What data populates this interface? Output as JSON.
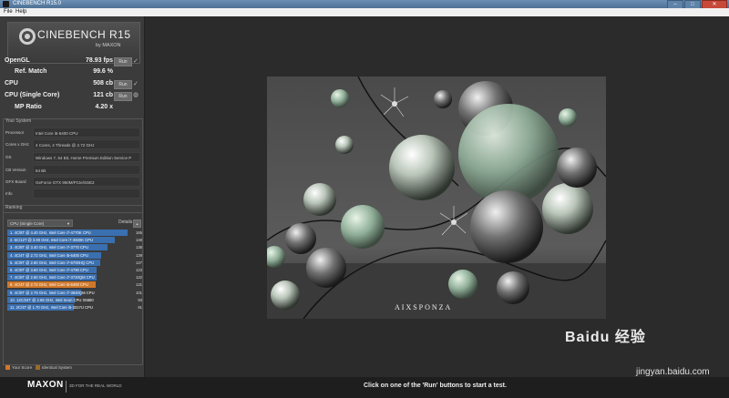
{
  "window": {
    "title": "CINEBENCH R15.0"
  },
  "menu": {
    "file": "File",
    "help": "Help"
  },
  "logo": {
    "name": "CINEBENCH R15",
    "by": "by MAXON"
  },
  "results": {
    "opengl_label": "OpenGL",
    "opengl_value": "78.93 fps",
    "refmatch_label": "Ref. Match",
    "refmatch_value": "99.6 %",
    "cpu_label": "CPU",
    "cpu_value": "508 cb",
    "cpu_single_label": "CPU (Single Core)",
    "cpu_single_value": "121 cb",
    "mp_label": "MP Ratio",
    "mp_value": "4.20 x",
    "run_label": "Run"
  },
  "system": {
    "header": "Your System",
    "rows": [
      {
        "label": "Processor",
        "value": "Intel Core i5-6400 CPU"
      },
      {
        "label": "Cores x GHz",
        "value": "4 Cores, 4 Threads @ 2.72 GHz"
      },
      {
        "label": "OS",
        "value": "Windows 7, 64 Bit, Home Premium Edition Service P"
      },
      {
        "label": "CB Version",
        "value": "64 Bit"
      },
      {
        "label": "GFX Board",
        "value": "GeForce GTX 950M/PCIe/SSE2"
      },
      {
        "label": "Info",
        "value": ""
      }
    ]
  },
  "ranking": {
    "header": "Ranking",
    "selected": "CPU (Single Core)",
    "details": "Details",
    "max_score": 165,
    "rows": [
      {
        "label": "1. 4C/8T @ 4.40 GHz, Intel Core i7-4770K CPU",
        "score": 165,
        "kind": "ref"
      },
      {
        "label": "2. 6C/12T @ 3.90 GHz, Intel Core i7-3930K CPU",
        "score": 148,
        "kind": "ref"
      },
      {
        "label": "3. 4C/8T @ 3.40 GHz, Intel Core i7-3770 CPU",
        "score": 138,
        "kind": "ref"
      },
      {
        "label": "4. 4C/4T @ 2.72 GHz, Intel Core i5-6400 CPU",
        "score": 129,
        "kind": "ref"
      },
      {
        "label": "5. 4C/8T @ 2.60 GHz, Intel Core i7-6700HQ CPU",
        "score": 127,
        "kind": "ref"
      },
      {
        "label": "6. 4C/8T @ 3.60 GHz, Intel Core i7-4790 CPU",
        "score": 123,
        "kind": "ref"
      },
      {
        "label": "7. 4C/8T @ 2.60 GHz, Intel Core i7-3720QM CPU",
        "score": 122,
        "kind": "ref"
      },
      {
        "label": "8. 4C/4T @ 2.72 GHz, Intel Core i5-6400 CPU",
        "score": 121,
        "kind": "yours"
      },
      {
        "label": "9. 4C/8T @ 2.79 GHz, Intel Core i7-3840QM CPU",
        "score": 101,
        "kind": "ref"
      },
      {
        "label": "10. 12C/24T @ 2.66 GHz, Intel Xeon CPU X5650",
        "score": 93,
        "kind": "ref"
      },
      {
        "label": "11. 2C/4T @ 1.70 GHz, Intel Core i5-3317U CPU",
        "score": 91,
        "kind": "ref"
      }
    ],
    "legend_yours": "Your Score",
    "legend_identical": "Identical System"
  },
  "footer": {
    "brand": "MAXON",
    "tagline": "3D FOR THE REAL WORLD",
    "status": "Click on one of the 'Run' buttons to start a test."
  },
  "render": {
    "watermark": "AIXSPONZA"
  },
  "overlay": {
    "baidu": "Baidu 经验",
    "url": "jingyan.baidu.com"
  },
  "colors": {
    "accent": "#3a6fb0",
    "yours": "#d0782a",
    "ref": "#3a6fb0"
  }
}
